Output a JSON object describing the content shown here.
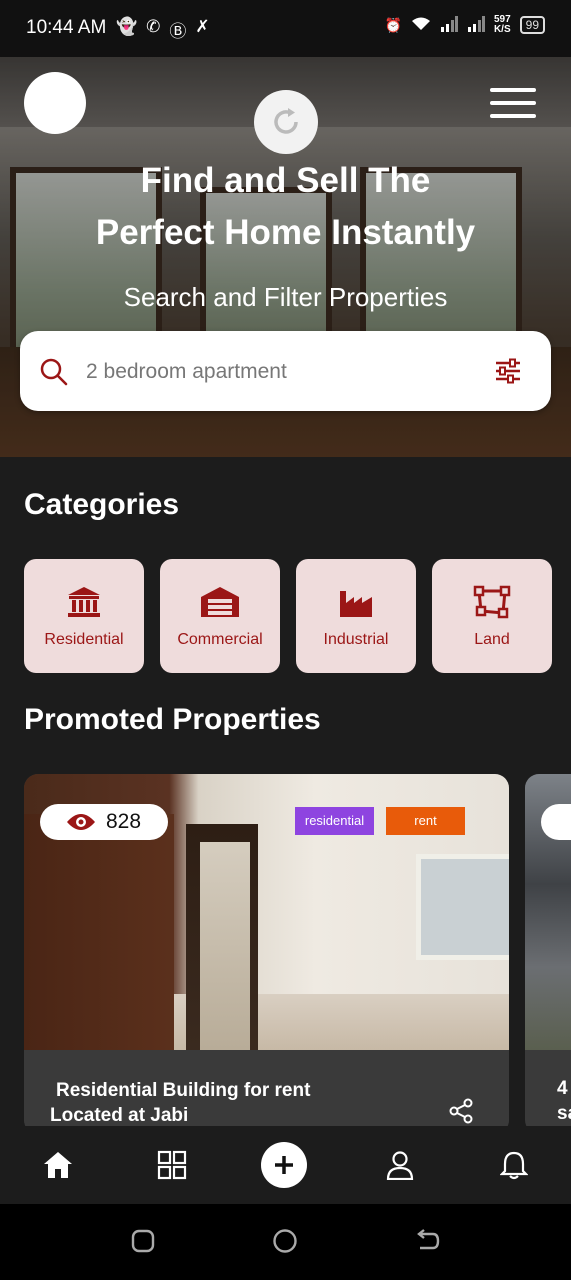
{
  "status_bar": {
    "time": "10:44 AM",
    "speed_top": "597",
    "speed_bottom": "K/S",
    "battery": "99"
  },
  "hero": {
    "title_line1": "Find and Sell The",
    "title_line2": "Perfect Home Instantly",
    "subtitle": "Search and Filter Properties"
  },
  "search": {
    "placeholder": "2 bedroom apartment"
  },
  "categories": {
    "heading": "Categories",
    "items": [
      {
        "label": "Residential",
        "icon": "bank-icon"
      },
      {
        "label": "Commercial",
        "icon": "warehouse-icon"
      },
      {
        "label": "Industrial",
        "icon": "factory-icon"
      },
      {
        "label": "Land",
        "icon": "land-plot-icon"
      }
    ]
  },
  "promoted": {
    "heading": "Promoted Properties",
    "cards": [
      {
        "views": "828",
        "tag_type": "residential",
        "tag_purpose": "rent",
        "title_line1": "Residential Building for rent",
        "title_line2": "Located at Jabi"
      },
      {
        "title_line1": "4",
        "title_line2": "sa"
      }
    ]
  },
  "colors": {
    "accent": "#9b1616",
    "category_bg": "#efdcdc",
    "tag_residential": "#8e44e0",
    "tag_rent": "#e85b0a"
  }
}
